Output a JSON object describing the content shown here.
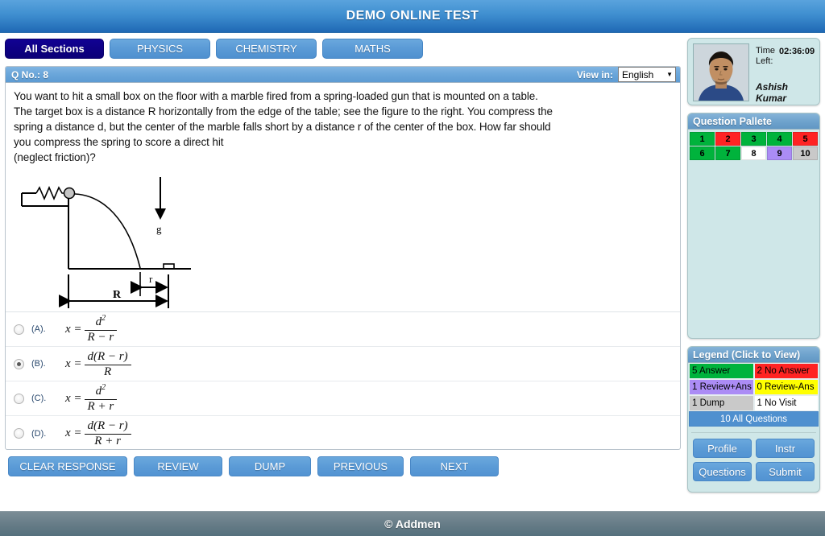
{
  "header": {
    "title": "DEMO ONLINE TEST"
  },
  "tabs": [
    {
      "label": "All Sections",
      "active": true
    },
    {
      "label": "PHYSICS",
      "active": false
    },
    {
      "label": "CHEMISTRY",
      "active": false
    },
    {
      "label": "MATHS",
      "active": false
    }
  ],
  "question": {
    "number_label": "Q No.: 8",
    "view_in_label": "View in:",
    "language_selected": "English",
    "language_options": [
      "English"
    ],
    "text_lines": [
      "You want to hit a small box on the floor with a marble fired from a spring-loaded gun that is mounted on a table.",
      "The target box is a distance R horizontally from the edge of the table; see the figure to the right. You compress the",
      "spring a distance d, but the center of the marble falls short by a distance r of the center of the box. How far should",
      "you compress the spring to score a direct hit",
      "(neglect friction)?"
    ],
    "figure": {
      "gravity_label": "g",
      "distance_R_label": "R",
      "distance_r_label": "r"
    },
    "options": [
      {
        "tag": "(A).",
        "lhs": "x =",
        "numerator": "d",
        "numerator_sup": "2",
        "denominator": "R − r",
        "selected": false
      },
      {
        "tag": "(B).",
        "lhs": "x =",
        "numerator": "d(R − r)",
        "numerator_sup": "",
        "denominator": "R",
        "selected": true
      },
      {
        "tag": "(C).",
        "lhs": "x =",
        "numerator": "d",
        "numerator_sup": "2",
        "denominator": "R + r",
        "selected": false
      },
      {
        "tag": "(D).",
        "lhs": "x =",
        "numerator": "d(R − r)",
        "numerator_sup": "",
        "denominator": "R + r",
        "selected": false
      }
    ]
  },
  "actions": [
    {
      "label": "CLEAR RESPONSE"
    },
    {
      "label": "REVIEW"
    },
    {
      "label": "DUMP"
    },
    {
      "label": "PREVIOUS"
    },
    {
      "label": "NEXT"
    }
  ],
  "profile": {
    "time_label_line1": "Time",
    "time_label_line2": "Left:",
    "time_value": "02:36:09",
    "user_name": "Ashish Kumar"
  },
  "pallete": {
    "title": "Question Pallete",
    "cells": [
      {
        "number": "1",
        "color": "#00b33c"
      },
      {
        "number": "2",
        "color": "#ff2323"
      },
      {
        "number": "3",
        "color": "#00b33c"
      },
      {
        "number": "4",
        "color": "#00b33c"
      },
      {
        "number": "5",
        "color": "#ff2323"
      },
      {
        "number": "6",
        "color": "#00b33c"
      },
      {
        "number": "7",
        "color": "#00b33c"
      },
      {
        "number": "8",
        "color": "#ffffff"
      },
      {
        "number": "9",
        "color": "#ab8cf5"
      },
      {
        "number": "10",
        "color": "#c9c9c9"
      }
    ]
  },
  "legend": {
    "title": "Legend (Click to View)",
    "items": [
      {
        "label": "5 Answer",
        "color": "#00b33c"
      },
      {
        "label": "2 No Answer",
        "color": "#ff2323"
      },
      {
        "label": "1 Review+Ans",
        "color": "#ab8cf5"
      },
      {
        "label": "0 Review-Ans",
        "color": "#ffff00"
      },
      {
        "label": "1 Dump",
        "color": "#c9c9c9"
      },
      {
        "label": "1 No Visit",
        "color": "#ffffff"
      }
    ],
    "all_questions": "10 All Questions",
    "buttons": [
      {
        "label": "Profile"
      },
      {
        "label": "Instr"
      },
      {
        "label": "Questions"
      },
      {
        "label": "Submit"
      }
    ]
  },
  "footer": {
    "text": "© Addmen"
  },
  "colors": {
    "brand_blue": "#4f90cf",
    "active_tab": "#110193",
    "card_bg": "#cfe7e8",
    "footer_gray": "#657b86"
  }
}
